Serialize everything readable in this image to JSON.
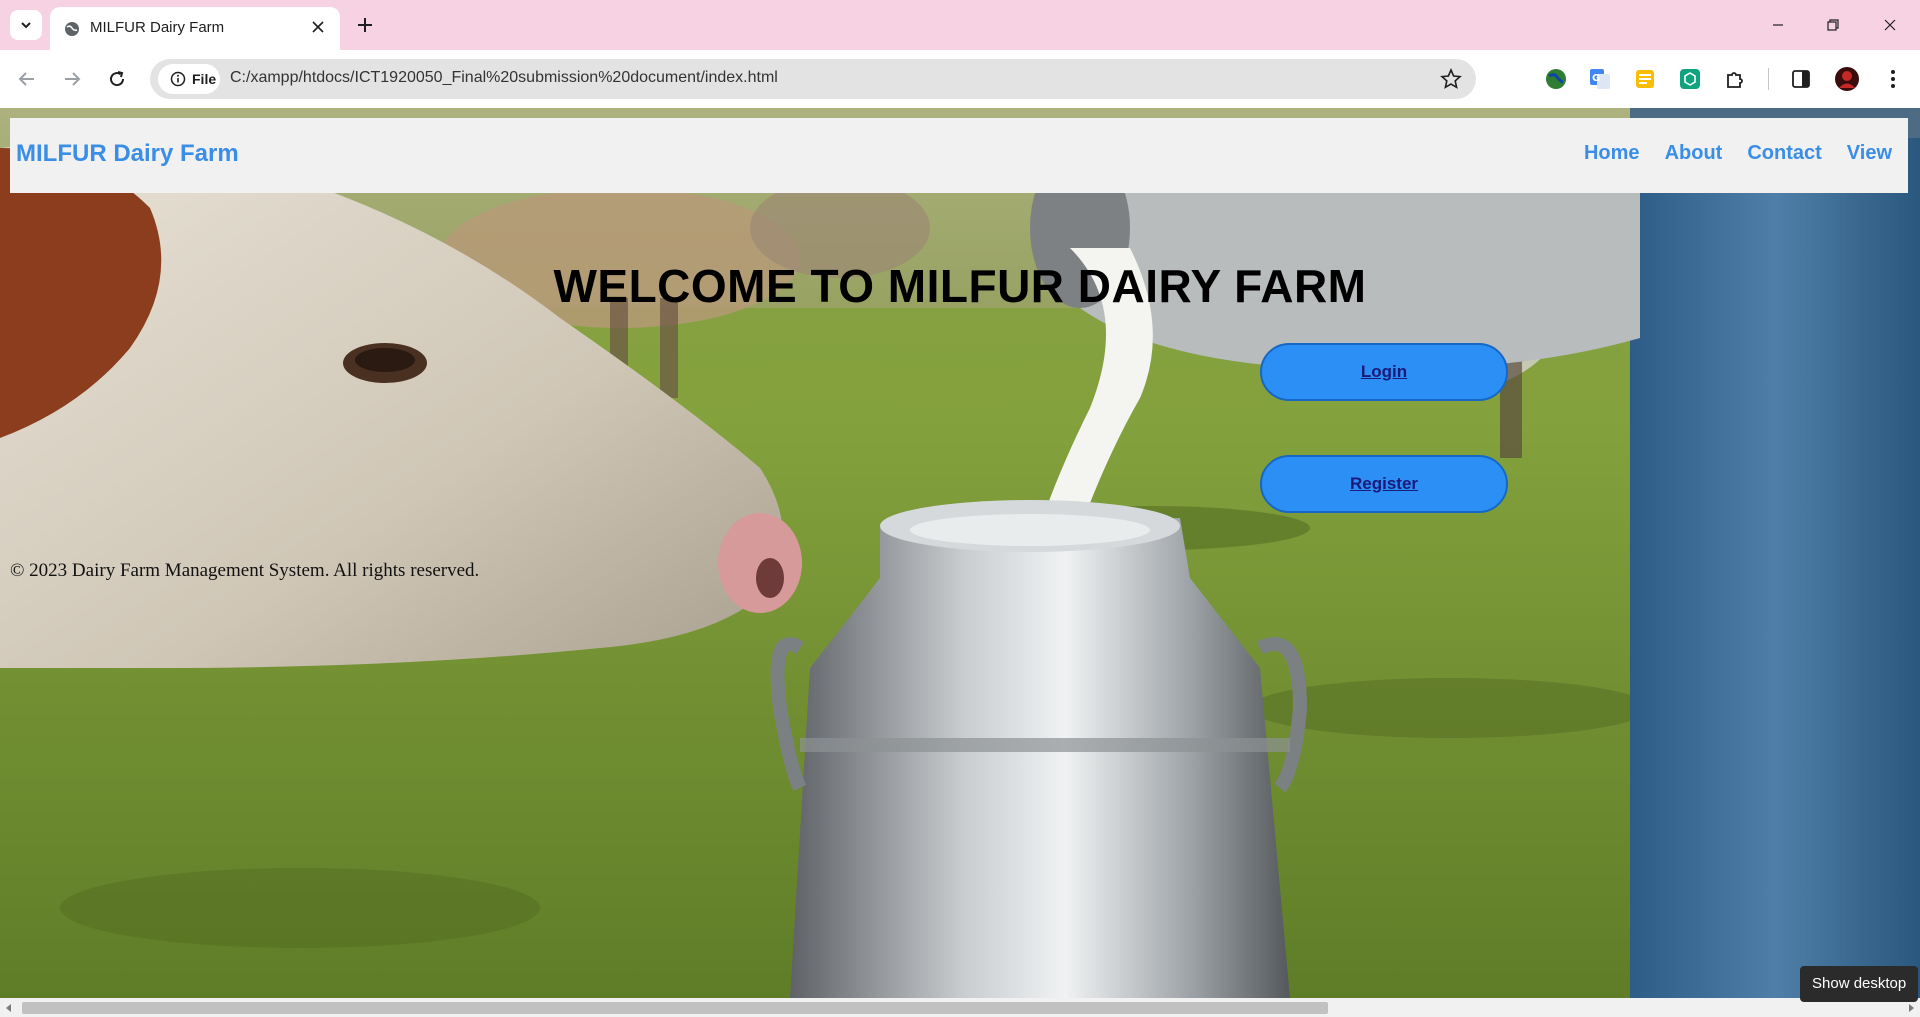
{
  "browser": {
    "tab_title": "MILFUR Dairy Farm",
    "chip_label": "File",
    "url": "C:/xampp/htdocs/ICT1920050_Final%20submission%20document/index.html"
  },
  "site": {
    "brand": "MILFUR Dairy Farm",
    "nav": [
      "Home",
      "About",
      "Contact",
      "View"
    ],
    "hero_title": "WELCOME TO MILFUR DAIRY FARM",
    "login_label": "Login",
    "register_label": "Register",
    "footer": "© 2023 Dairy Farm Management System. All rights reserved."
  },
  "tooltip": "Show desktop",
  "colors": {
    "tabstrip": "#f6d2e3",
    "brand": "#3a8ee6",
    "button": "#2b8ff5",
    "navbar": "#f1f1f1"
  }
}
